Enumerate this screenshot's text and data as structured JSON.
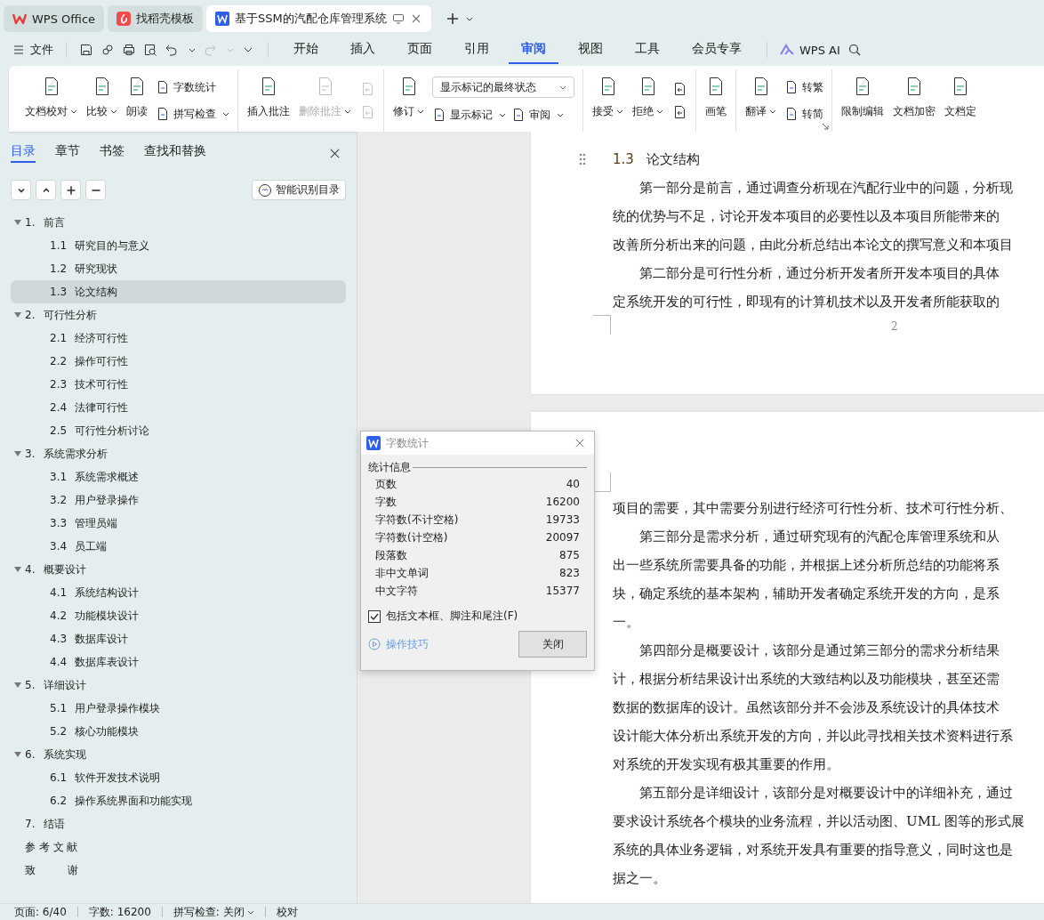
{
  "title_tabs": [
    {
      "label": "WPS Office",
      "kind": "home",
      "selected": false
    },
    {
      "label": "找稻壳模板",
      "kind": "template",
      "selected": false
    },
    {
      "label": "基于SSM的汽配仓库管理系统",
      "kind": "document",
      "selected": true
    }
  ],
  "menu": {
    "file": "文件",
    "tabs": [
      {
        "label": "开始",
        "selected": false
      },
      {
        "label": "插入",
        "selected": false
      },
      {
        "label": "页面",
        "selected": false
      },
      {
        "label": "引用",
        "selected": false
      },
      {
        "label": "审阅",
        "selected": true
      },
      {
        "label": "视图",
        "selected": false
      },
      {
        "label": "工具",
        "selected": false
      },
      {
        "label": "会员专享",
        "selected": false
      }
    ],
    "ai": "WPS AI"
  },
  "ribbon": {
    "groups": [
      {
        "columns": [
          {
            "kind": "large",
            "label": "文档校对",
            "caret": true,
            "disabled": false
          },
          {
            "kind": "large",
            "label": "比较",
            "caret": true,
            "disabled": false
          },
          {
            "kind": "large",
            "label": "朗读",
            "caret": false,
            "disabled": false
          },
          {
            "kind": "stack",
            "rows": [
              [
                {
                  "kind": "small",
                  "label": "字数统计",
                  "caret": false,
                  "disabled": false
                }
              ],
              [
                {
                  "kind": "small",
                  "label": "拼写检查",
                  "caret": true,
                  "disabled": false
                }
              ]
            ]
          }
        ]
      },
      {
        "columns": [
          {
            "kind": "large",
            "label": "插入批注",
            "caret": false,
            "disabled": false
          },
          {
            "kind": "large",
            "label": "删除批注",
            "caret": true,
            "disabled": true
          },
          {
            "kind": "stack",
            "rows": [
              [
                {
                  "kind": "icon",
                  "disabled": true
                }
              ],
              [
                {
                  "kind": "icon",
                  "disabled": true
                }
              ]
            ]
          }
        ]
      },
      {
        "columns": [
          {
            "kind": "large",
            "label": "修订",
            "caret": true,
            "disabled": false
          },
          {
            "kind": "stack",
            "rows": [
              [
                {
                  "kind": "select",
                  "label": "显示标记的最终状态",
                  "caret": true
                }
              ],
              [
                {
                  "kind": "small",
                  "label": "显示标记",
                  "caret": true,
                  "disabled": false
                },
                {
                  "kind": "small",
                  "label": "审阅",
                  "caret": true,
                  "disabled": false
                }
              ]
            ]
          }
        ]
      },
      {
        "columns": [
          {
            "kind": "large",
            "label": "接受",
            "caret": true,
            "disabled": false
          },
          {
            "kind": "large",
            "label": "拒绝",
            "caret": true,
            "disabled": false
          },
          {
            "kind": "stack",
            "rows": [
              [
                {
                  "kind": "icon",
                  "disabled": false
                }
              ],
              [
                {
                  "kind": "icon",
                  "disabled": false
                }
              ]
            ]
          }
        ]
      },
      {
        "columns": [
          {
            "kind": "large",
            "label": "画笔",
            "caret": false,
            "disabled": false
          }
        ]
      },
      {
        "launcher": true,
        "columns": [
          {
            "kind": "large",
            "label": "翻译",
            "caret": true,
            "disabled": false
          },
          {
            "kind": "stack",
            "rows": [
              [
                {
                  "kind": "small",
                  "label": "转繁",
                  "caret": false,
                  "disabled": false
                }
              ],
              [
                {
                  "kind": "small",
                  "label": "转简",
                  "caret": false,
                  "disabled": false
                }
              ]
            ]
          }
        ]
      },
      {
        "columns": [
          {
            "kind": "large",
            "label": "限制编辑",
            "caret": false,
            "disabled": false
          },
          {
            "kind": "large",
            "label": "文档加密",
            "caret": false,
            "disabled": false
          },
          {
            "kind": "large",
            "label": "文档定",
            "caret": false,
            "disabled": false
          }
        ]
      }
    ]
  },
  "sidebar": {
    "tabs": [
      {
        "label": "目录",
        "selected": true
      },
      {
        "label": "章节",
        "selected": false
      },
      {
        "label": "书签",
        "selected": false
      },
      {
        "label": "查找和替换",
        "selected": false
      }
    ],
    "smart_button": "智能识别目录",
    "tree": [
      {
        "num": "1.",
        "title": "前言",
        "expanded": true,
        "selected": false,
        "children": [
          {
            "num": "1.1",
            "title": "研究目的与意义",
            "selected": false
          },
          {
            "num": "1.2",
            "title": "研究现状",
            "selected": false
          },
          {
            "num": "1.3",
            "title": "论文结构",
            "selected": true
          }
        ]
      },
      {
        "num": "2.",
        "title": "可行性分析",
        "expanded": true,
        "selected": false,
        "children": [
          {
            "num": "2.1",
            "title": "经济可行性",
            "selected": false
          },
          {
            "num": "2.2",
            "title": "操作可行性",
            "selected": false
          },
          {
            "num": "2.3",
            "title": "技术可行性",
            "selected": false
          },
          {
            "num": "2.4",
            "title": "法律可行性",
            "selected": false
          },
          {
            "num": "2.5",
            "title": "可行性分析讨论",
            "selected": false
          }
        ]
      },
      {
        "num": "3.",
        "title": "系统需求分析",
        "expanded": true,
        "selected": false,
        "children": [
          {
            "num": "3.1",
            "title": "系统需求概述",
            "selected": false
          },
          {
            "num": "3.2",
            "title": "用户登录操作",
            "selected": false
          },
          {
            "num": "3.3",
            "title": "管理员端",
            "selected": false
          },
          {
            "num": "3.4",
            "title": "员工端",
            "selected": false
          }
        ]
      },
      {
        "num": "4.",
        "title": "概要设计",
        "expanded": true,
        "selected": false,
        "children": [
          {
            "num": "4.1",
            "title": "系统结构设计",
            "selected": false
          },
          {
            "num": "4.2",
            "title": "功能模块设计",
            "selected": false
          },
          {
            "num": "4.3",
            "title": "数据库设计",
            "selected": false
          },
          {
            "num": "4.4",
            "title": "数据库表设计",
            "selected": false
          }
        ]
      },
      {
        "num": "5.",
        "title": "详细设计",
        "expanded": true,
        "selected": false,
        "children": [
          {
            "num": "5.1",
            "title": "用户登录操作模块",
            "selected": false
          },
          {
            "num": "5.2",
            "title": "核心功能模块",
            "selected": false
          }
        ]
      },
      {
        "num": "6.",
        "title": "系统实现",
        "expanded": true,
        "selected": false,
        "children": [
          {
            "num": "6.1",
            "title": "软件开发技术说明",
            "selected": false
          },
          {
            "num": "6.2",
            "title": "操作系统界面和功能实现",
            "selected": false
          }
        ]
      },
      {
        "num": "7.",
        "title": "结语",
        "selected": false
      },
      {
        "title": "参 考 文 献",
        "selected": false
      },
      {
        "title": "致　　　谢",
        "selected": false
      }
    ]
  },
  "document": {
    "pages": [
      {
        "page_number": "2",
        "lines": [
          {
            "kind": "heading",
            "num": "1.3",
            "text": "论文结构"
          },
          {
            "kind": "indent",
            "text": "第一部分是前言，通过调查分析现在汽配行业中的问题，分析现"
          },
          {
            "kind": "line",
            "text": "统的优势与不足，讨论开发本项目的必要性以及本项目所能带来的"
          },
          {
            "kind": "line",
            "text": "改善所分析出来的问题，由此分析总结出本论文的撰写意义和本项目"
          },
          {
            "kind": "indent",
            "text": "第二部分是可行性分析，通过分析开发者所开发本项目的具体"
          },
          {
            "kind": "line",
            "text": "定系统开发的可行性，即现有的计算机技术以及开发者所能获取的"
          }
        ]
      },
      {
        "lines": [
          {
            "kind": "line",
            "text": "项目的需要，其中需要分别进行经济可行性分析、技术可行性分析、"
          },
          {
            "kind": "indent",
            "text": "第三部分是需求分析，通过研究现有的汽配仓库管理系统和从"
          },
          {
            "kind": "line",
            "text": "出一些系统所需要具备的功能，并根据上述分析所总结的功能将系"
          },
          {
            "kind": "line",
            "text": "块，确定系统的基本架构，辅助开发者确定系统开发的方向，是系"
          },
          {
            "kind": "line",
            "text": "一。"
          },
          {
            "kind": "indent",
            "text": "第四部分是概要设计，该部分是通过第三部分的需求分析结果"
          },
          {
            "kind": "line",
            "text": "计，根据分析结果设计出系统的大致结构以及功能模块，甚至还需"
          },
          {
            "kind": "line",
            "text": "数据的数据库的设计。虽然该部分并不会涉及系统设计的具体技术"
          },
          {
            "kind": "line",
            "text": "设计能大体分析出系统开发的方向，并以此寻找相关技术资料进行系"
          },
          {
            "kind": "line",
            "text": "对系统的开发实现有极其重要的作用。"
          },
          {
            "kind": "indent",
            "text": "第五部分是详细设计，该部分是对概要设计中的详细补充，通过"
          },
          {
            "kind": "line",
            "text": "要求设计系统各个模块的业务流程，并以活动图、UML 图等的形式展"
          },
          {
            "kind": "line",
            "text": "系统的具体业务逻辑，对系统开发具有重要的指导意义，同时这也是"
          },
          {
            "kind": "line",
            "text": "据之一。"
          }
        ]
      }
    ]
  },
  "dialog": {
    "title": "字数统计",
    "section": "统计信息",
    "stats": [
      {
        "label": "页数",
        "value": "40"
      },
      {
        "label": "字数",
        "value": "16200"
      },
      {
        "label": "字符数(不计空格)",
        "value": "19733"
      },
      {
        "label": "字符数(计空格)",
        "value": "20097"
      },
      {
        "label": "段落数",
        "value": "875"
      },
      {
        "label": "非中文单词",
        "value": "823"
      },
      {
        "label": "中文字符",
        "value": "15377"
      }
    ],
    "include": {
      "label": "包括文本框、脚注和尾注(F)",
      "checked": true
    },
    "tips": "操作技巧",
    "close": "关闭"
  },
  "status_bar": {
    "items": [
      {
        "label": "页面: 6/40",
        "caret": false
      },
      {
        "label": "字数: 16200",
        "caret": false
      },
      {
        "label": "拼写检查: 关闭",
        "caret": true
      },
      {
        "label": "校对",
        "caret": false
      }
    ]
  }
}
